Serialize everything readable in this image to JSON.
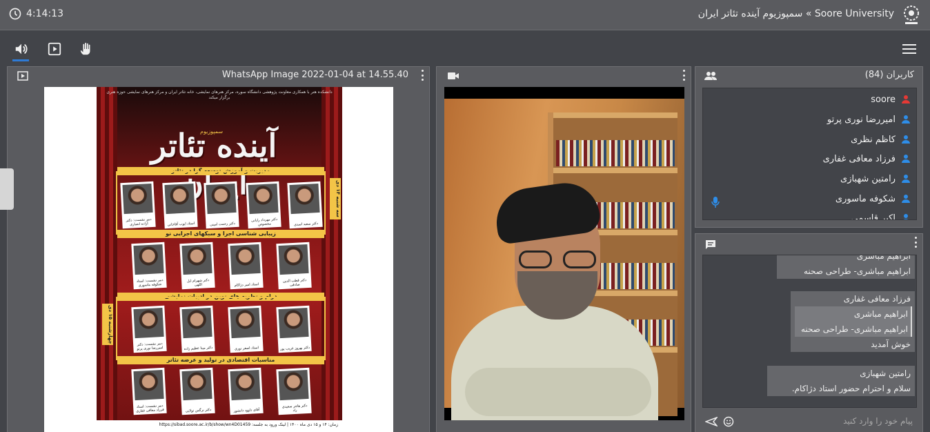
{
  "topbar": {
    "timer": "4:14:13",
    "title": "Soore University » سمپوزیوم آینده تئاتر ایران"
  },
  "toolbar": {
    "items": [
      "speaker-icon",
      "presentation-icon",
      "raise-hand-icon"
    ],
    "active": "speaker-icon",
    "menu_icon": "hamburger-icon"
  },
  "presentation": {
    "title": "WhatsApp Image 2022-01-04 at 14.55.40",
    "poster": {
      "top_text": "دانشکده هنر با همکاری معاونت پژوهشی دانشگاه سوره، مرکز هنرهای نمایشی، خانه تئاتر ایران و مرکز هنرهای نمایشی حوزه هنری برگزار میکند",
      "heading": "آینده تئاتر ایران",
      "subheading": "سمپوزیوم",
      "sessions": [
        {
          "title": "مدیریت و آموزش توسعه گرا در تئاتر",
          "time": "۱۴ الی ۱۶:۳۰",
          "day": "سه شنبه ۱۴ دی"
        },
        {
          "title": "زیبایی شناسی اجرا و سبکهای اجرایی نو",
          "time": "۱۷:۳۰ الی ۲۰",
          "day": ""
        },
        {
          "title": "درام و نظریه های نوین در ادبیات نمایشی",
          "time": "۱۴ الی ۱۶:۳۰",
          "day": "چهارشنبه ۱۵ دی"
        },
        {
          "title": "مناسبات اقتصادی در تولید و عرضه تئاتر",
          "time": "۱۷:۳۰ الی ۲۰",
          "day": ""
        }
      ],
      "speakers": [
        [
          "دکتر سعید اسدی",
          "دکتر مهرداد رایانی مخصوص",
          "دکتر رحمت امینی",
          "استاد ایوب آقاخانی",
          "دبیر نشست: دکتر آزاده انصاری"
        ],
        [
          "دکتر قطب الدین صادقی",
          "استاد امیر دژاکام",
          "دکتر شهرام ابل اللهی",
          "دبیر نشست: استاد شکوفه ماسوری"
        ],
        [
          "دکتر بهروز غریب پور",
          "استاد اصغر نوری",
          "دکتر مینا عظیم زاده",
          "دبیر نشست: دکتر امیررضا نوری پرتو"
        ],
        [
          "دکتر هاجر سعیدی راد",
          "آقای داوود دانشور",
          "دکتر نرگس تولایی",
          "دبیر نشست: استاد فرزاد معافی غفاری"
        ]
      ],
      "footer": "زمان: ۱۴ و ۱۵ دی ماه ۱۴۰۰ | لینک ورود به جلسه: https://sibad.soore.ac.ir/b/show/wn4D01459"
    }
  },
  "video": {
    "icon": "camera-icon"
  },
  "users": {
    "title": "کاربران (84)",
    "list": [
      {
        "name": "soore",
        "color": "#e53935"
      },
      {
        "name": "امیررضا نوری پرتو",
        "color": "#2e8de8"
      },
      {
        "name": "کاظم نظری",
        "color": "#2e8de8"
      },
      {
        "name": "فرزاد معافی غفاری",
        "color": "#2e8de8"
      },
      {
        "name": "رامتین شهبازی",
        "color": "#2e8de8"
      },
      {
        "name": "شکوفه ماسوری",
        "color": "#2e8de8"
      },
      {
        "name": "اکبر قاسمی...",
        "color": "#2e8de8"
      }
    ]
  },
  "chat": {
    "messages": [
      {
        "sender": "ابراهیم مباشری",
        "lines": [
          "ابراهیم مباشری- طراحی صحنه"
        ]
      },
      {
        "sender": "فرزاد معافی غفاری",
        "quote": [
          "ابراهیم مباشری",
          "ابراهیم مباشری- طراحی صحنه"
        ],
        "lines": [
          "خوش آمدید"
        ]
      },
      {
        "sender": "رامتین شهبازی",
        "lines": [
          "سلام و احترام حضور استاد دژاکام."
        ]
      }
    ],
    "input_placeholder": "پیام خود را وارد کنید"
  }
}
